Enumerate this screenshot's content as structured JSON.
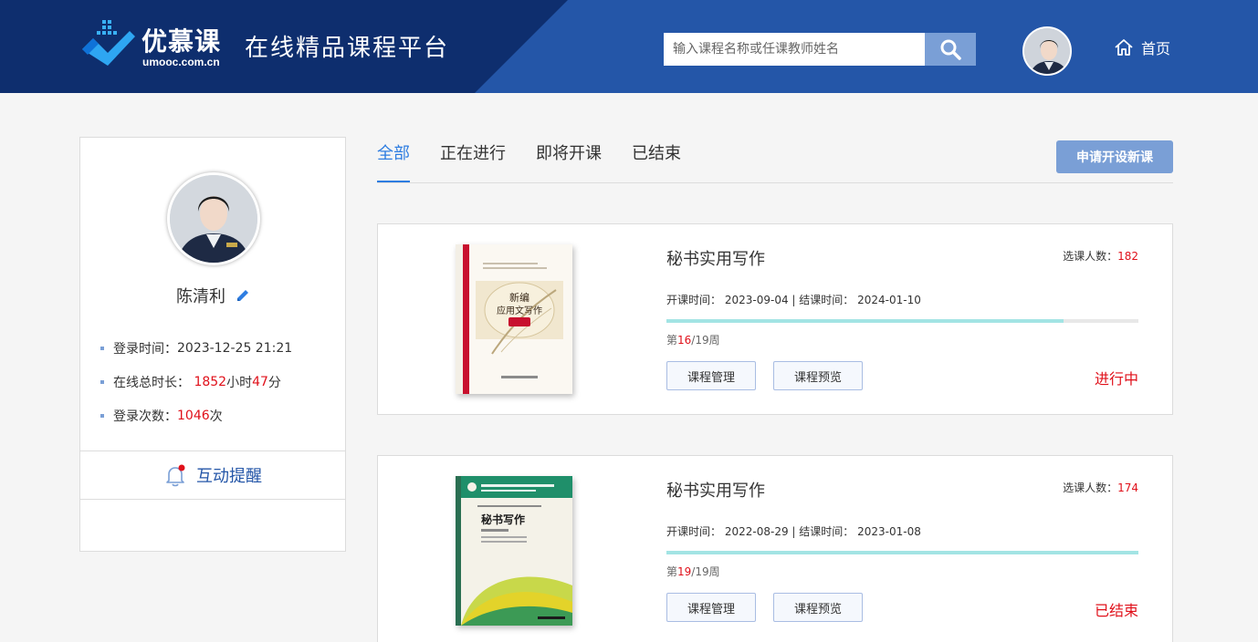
{
  "header": {
    "brand_name": "优慕课",
    "brand_url": "umooc.com.cn",
    "platform_title": "在线精品课程平台",
    "search_placeholder": "输入课程名称或任课教师姓名",
    "home_label": "首页",
    "colors": {
      "header_bg": "#2456a8",
      "header_dark": "#0e2e6e",
      "search_button": "#7a9fd6"
    }
  },
  "profile": {
    "name": "陈清利",
    "login_time_label": "登录时间：",
    "login_time_value": "2023-12-25 21:21",
    "online_label": "在线总时长：",
    "online_hours": "1852",
    "hours_unit": "小时",
    "online_minutes": "47",
    "minutes_unit": "分",
    "login_count_label": "登录次数：",
    "login_count_value": "1046",
    "login_count_unit": "次",
    "notice_label": "互动提醒"
  },
  "tabs": [
    {
      "label": "全部",
      "active": true
    },
    {
      "label": "正在进行",
      "active": false
    },
    {
      "label": "即将开课",
      "active": false
    },
    {
      "label": "已结束",
      "active": false
    }
  ],
  "apply_button": "申请开设新课",
  "courses": [
    {
      "title": "秘书实用写作",
      "enroll_label": "选课人数：",
      "enroll_count": "182",
      "start_label": "开课时间：",
      "start_date": "2023-09-04",
      "separator": "|",
      "end_label": "结课时间：",
      "end_date": "2024-01-10",
      "week_prefix": "第",
      "week_current": "16",
      "week_total": "/19周",
      "progress": 0.842,
      "manage_label": "课程管理",
      "preview_label": "课程预览",
      "status": "进行中",
      "cover_title": "新编应用文写作教程"
    },
    {
      "title": "秘书实用写作",
      "enroll_label": "选课人数：",
      "enroll_count": "174",
      "start_label": "开课时间：",
      "start_date": "2022-08-29",
      "separator": "|",
      "end_label": "结课时间：",
      "end_date": "2023-01-08",
      "week_prefix": "第",
      "week_current": "19",
      "week_total": "/19周",
      "progress": 1.0,
      "manage_label": "课程管理",
      "preview_label": "课程预览",
      "status": "已结束",
      "cover_title": "秘书写作"
    }
  ]
}
